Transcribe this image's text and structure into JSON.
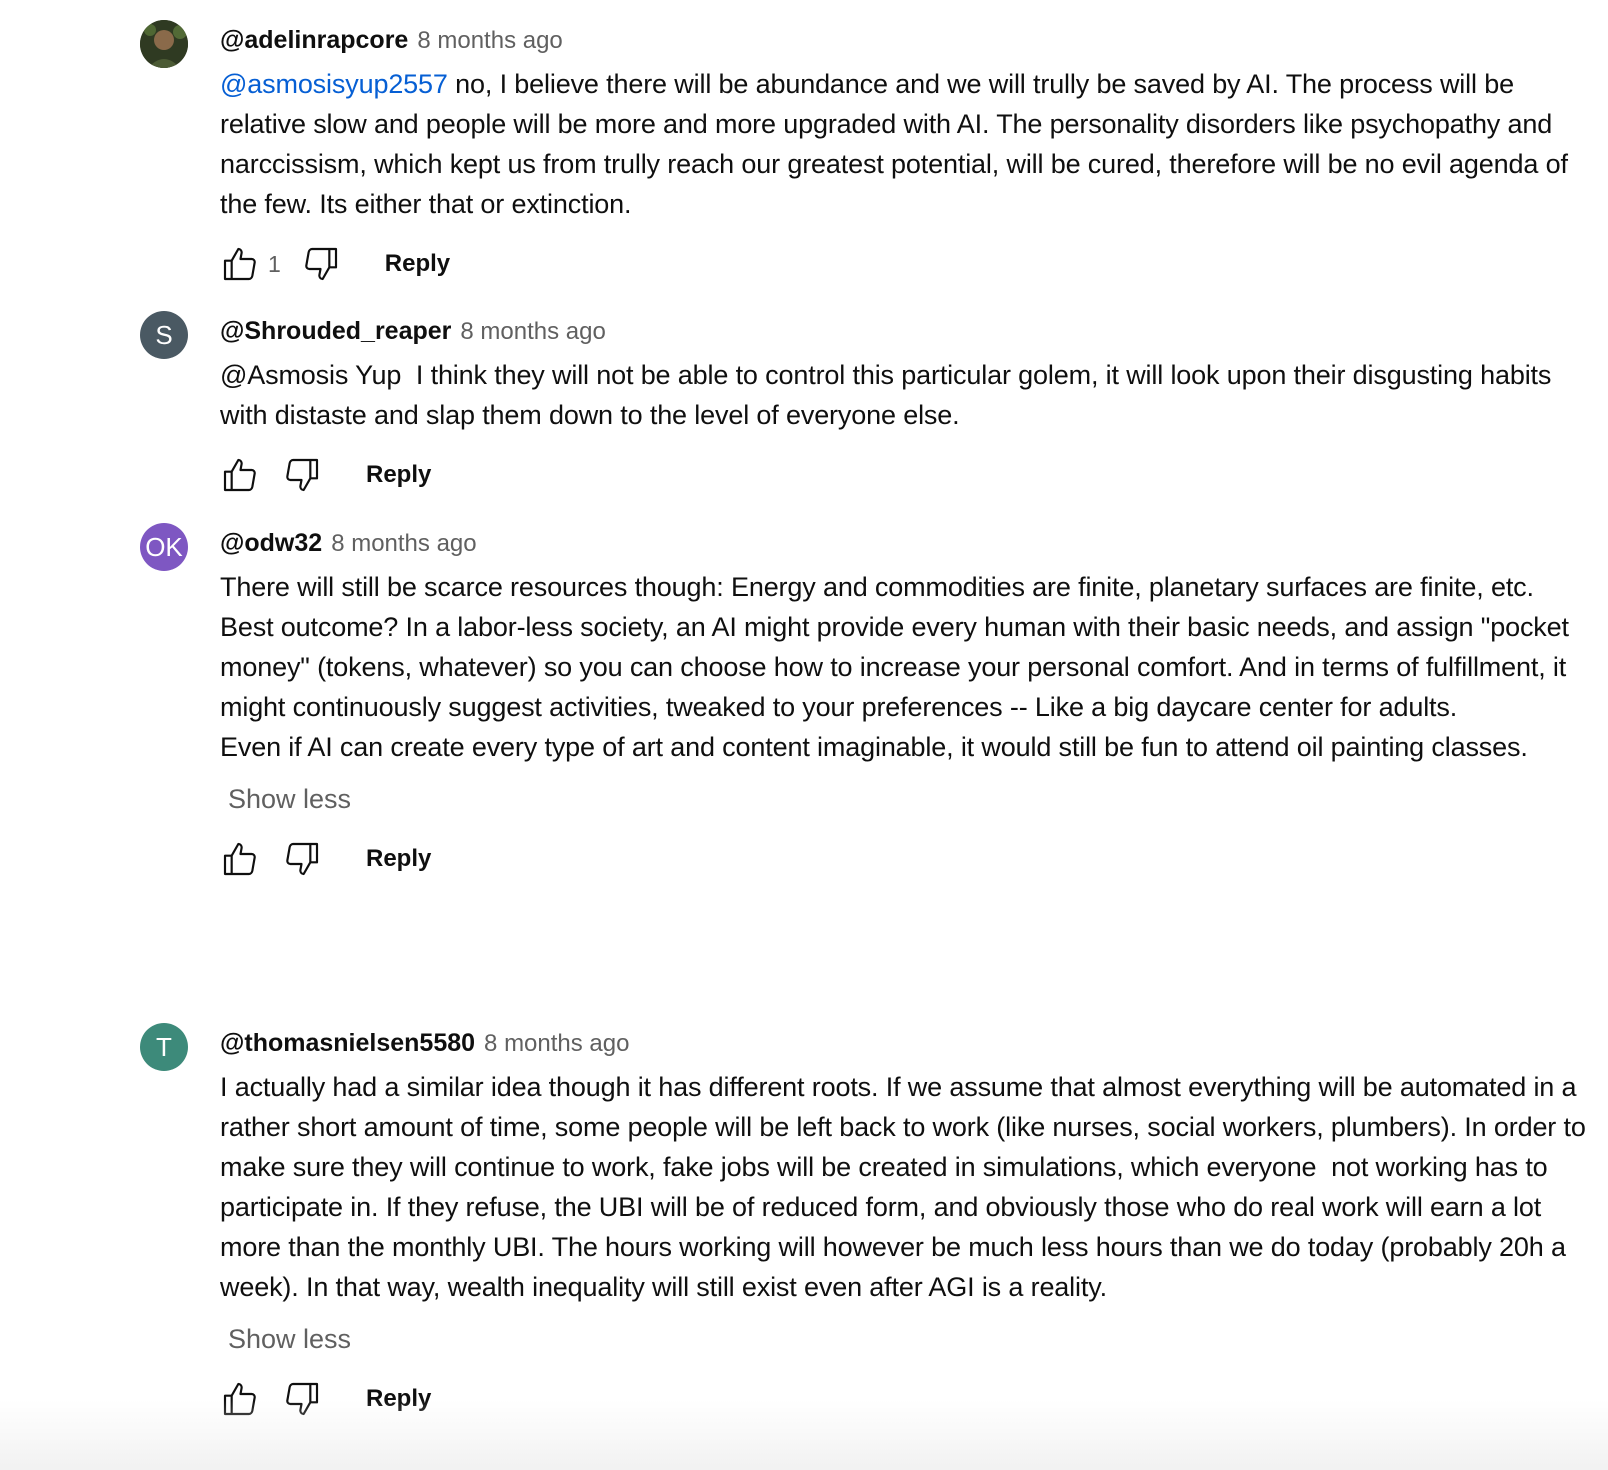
{
  "comments": [
    {
      "author": "@adelinrapcore",
      "time": "8 months ago",
      "avatar_letter": "",
      "avatar_color": "#3e4a2e",
      "mention": "@asmosisyup2557",
      "text": " no, I believe there will be abundance and we will trully be saved by AI. The process will be relative slow and people will be more and more upgraded with AI. The personality disorders like psychopathy and narccissism, which kept us from trully reach our greatest potential, will be cured, therefore will be no evil agenda of the few. Its either that or extinction.",
      "likes": "1",
      "reply_label": "Reply"
    },
    {
      "author": "@Shrouded_reaper",
      "time": "8 months ago",
      "avatar_letter": "S",
      "avatar_color": "#4a5963",
      "text": "@Asmosis Yup  I think they will not be able to control this particular golem, it will look upon their disgusting habits with distaste and slap them down to the level of everyone else.",
      "reply_label": "Reply"
    },
    {
      "author": "@odw32",
      "time": "8 months ago",
      "avatar_letter": "OK",
      "avatar_color": "#7e57c2",
      "text": "There will still be scarce resources though: Energy and commodities are finite, planetary surfaces are finite, etc.\nBest outcome? In a labor-less society, an AI might provide every human with their basic needs, and assign \"pocket money\" (tokens, whatever) so you can choose how to increase your personal comfort. And in terms of fulfillment, it might continuously suggest activities, tweaked to your preferences -- Like a big daycare center for adults.\nEven if AI can create every type of art and content imaginable, it would still be fun to attend oil painting classes.",
      "show_less": "Show less",
      "reply_label": "Reply"
    },
    {
      "author": "@thomasnielsen5580",
      "time": "8 months ago",
      "avatar_letter": "T",
      "avatar_color": "#3d8a7a",
      "text": "I actually had a similar idea though it has different roots. If we assume that almost everything will be automated in a rather short amount of time, some people will be left back to work (like nurses, social workers, plumbers). In order to make sure they will continue to work, fake jobs will be created in simulations, which everyone  not working has to participate in. If they refuse, the UBI will be of reduced form, and obviously those who do real work will earn a lot more than the monthly UBI. The hours working will however be much less hours than we do today (probably 20h a week). In that way, wealth inequality will still exist even after AGI is a reality.",
      "show_less": "Show less",
      "reply_label": "Reply"
    }
  ]
}
